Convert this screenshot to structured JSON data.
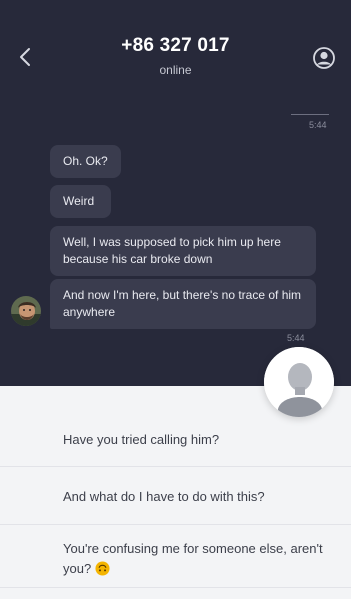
{
  "header": {
    "title": "+86 327 017",
    "status": "online",
    "back_icon": "chevron-left-icon",
    "profile_icon": "user-circle-icon"
  },
  "chat": {
    "sent_time": "5:44",
    "messages": [
      {
        "text": "Oh. Ok?"
      },
      {
        "text": "Weird"
      },
      {
        "text": "Well, I was supposed to pick him up here because his car broke down"
      },
      {
        "text": "And now I'm here, but there's no trace of him anywhere"
      }
    ],
    "received_time": "5:44"
  },
  "reply_options": [
    {
      "text": "Have you tried calling him?"
    },
    {
      "text": "And what do I have to do with this?"
    },
    {
      "text": "You're confusing me for someone else, aren't you?",
      "emoji": "upside-down-face-icon"
    }
  ],
  "colors": {
    "chat_background": "#27293a",
    "bubble": "#3a3c4e",
    "options_background": "#f3f4f6",
    "emoji": "#f4b400"
  }
}
